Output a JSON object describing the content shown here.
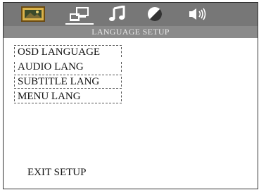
{
  "header": {
    "title": "LANGUAGE SETUP",
    "tabs": [
      {
        "icon": "picture-icon",
        "active": false
      },
      {
        "icon": "computer-language-icon",
        "active": true
      },
      {
        "icon": "music-note-icon",
        "active": false
      },
      {
        "icon": "contrast-icon",
        "active": false
      },
      {
        "icon": "speaker-icon",
        "active": false
      }
    ]
  },
  "menu": {
    "items": [
      "OSD LANGUAGE",
      "AUDIO LANG",
      "SUBTITLE LANG",
      "MENU LANG"
    ]
  },
  "footer": {
    "exit_label": "EXIT SETUP"
  },
  "colors": {
    "topbar": "#777777",
    "header_strip": "#8a8a8a",
    "selection_underline": "#ffffff"
  }
}
